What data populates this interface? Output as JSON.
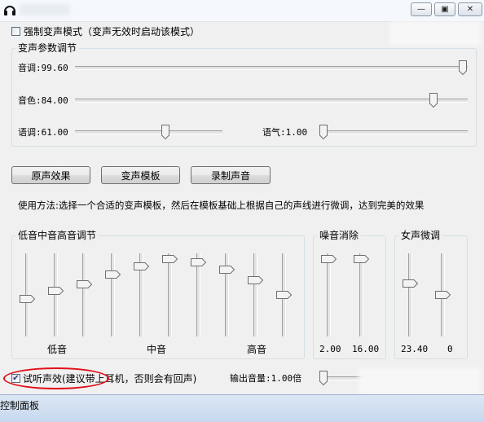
{
  "window": {
    "title_icon": "headphones-icon",
    "minimize_glyph": "—",
    "maximize_glyph": "▣",
    "close_glyph": "✕"
  },
  "force_mode": {
    "label": "强制变声模式（变声无效时启动该模式）",
    "checked": false
  },
  "params": {
    "title": "变声参数调节",
    "pitch": {
      "label": "音调:99.60",
      "value": 99.6
    },
    "timbre": {
      "label": "音色:84.00",
      "value": 84.0
    },
    "speed": {
      "label": "语调:61.00",
      "value": 61.0
    },
    "tone": {
      "label": "语气:1.00",
      "value": 1.0
    }
  },
  "buttons": {
    "original": "原声效果",
    "templates": "变声模板",
    "record": "录制声音"
  },
  "instructions": "使用方法:选择一个合适的变声模板，然后在模板基础上根据自己的声线进行微调，达到完美的效果",
  "eq": {
    "title": "低音中音高音调节",
    "labels": {
      "low": "低音",
      "mid": "中音",
      "high": "高音"
    },
    "bands": [
      0.45,
      0.55,
      0.64,
      0.77,
      0.88,
      0.98,
      0.94,
      0.84,
      0.7,
      0.5
    ]
  },
  "noise": {
    "title": "噪音消除",
    "sliders": [
      {
        "label": "2.00",
        "level": 0.98
      },
      {
        "label": "16.00",
        "level": 0.98
      }
    ]
  },
  "female": {
    "title": "女声微调",
    "sliders": [
      {
        "label": "23.40",
        "level": 0.65
      },
      {
        "label": "0",
        "level": 0.5
      }
    ]
  },
  "preview": {
    "label": "试听声效(建议带上耳机，否则会有回声)",
    "checked": true
  },
  "output": {
    "label": "输出音量:1.00倍",
    "value": 0.0
  },
  "taskbar": {
    "label": "控制面板"
  },
  "colors": {
    "highlight_oval": "#e0101a",
    "check_mark": "#203a80"
  }
}
